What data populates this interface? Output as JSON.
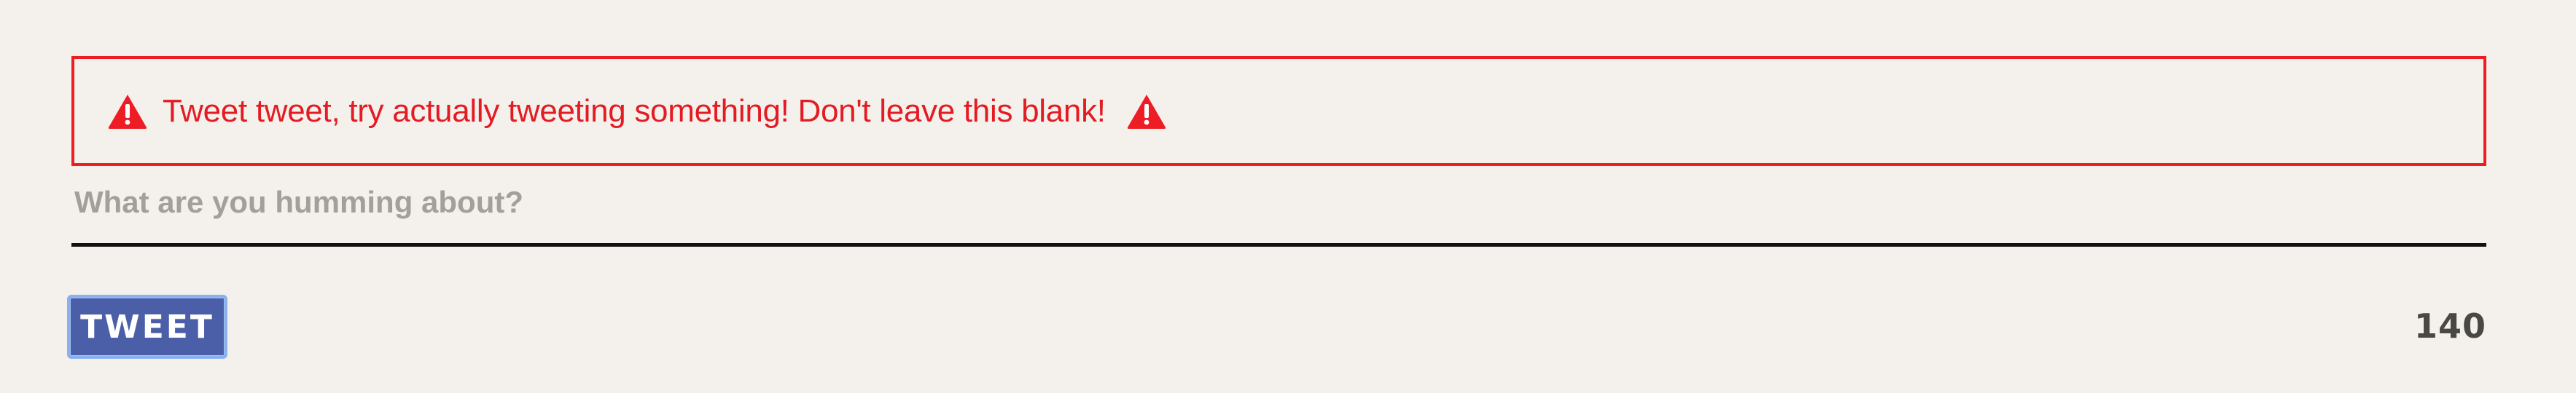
{
  "error": {
    "message": "Tweet tweet, try actually tweeting something! Don't leave this blank!",
    "icon": "warning-triangle-icon",
    "color": "#e31b23"
  },
  "compose": {
    "placeholder": "What are you humming about?",
    "value": ""
  },
  "actions": {
    "tweet_label": "TWEET",
    "tweet_color": "#4a5fa8"
  },
  "counter": {
    "remaining": "140"
  }
}
